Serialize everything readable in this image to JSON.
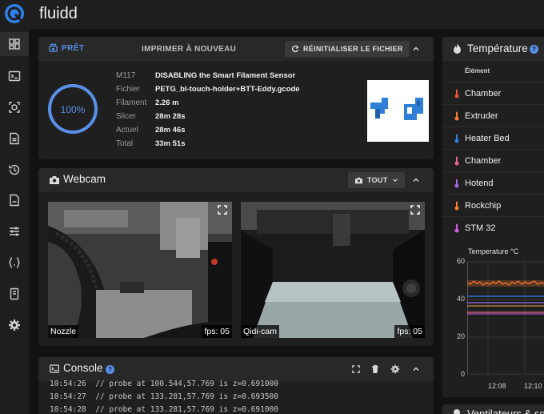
{
  "app": {
    "title": "fluidd"
  },
  "sidebar": {
    "items": [
      {
        "name": "dashboard",
        "icon": "dashboard-icon",
        "active": true
      },
      {
        "name": "console",
        "icon": "console-icon"
      },
      {
        "name": "webcam",
        "icon": "camera-icon"
      },
      {
        "name": "jobs",
        "icon": "file-list-icon"
      },
      {
        "name": "history",
        "icon": "history-icon"
      },
      {
        "name": "config",
        "icon": "file-icon"
      },
      {
        "name": "tune",
        "icon": "tune-icon"
      },
      {
        "name": "macros",
        "icon": "braces-icon"
      },
      {
        "name": "system",
        "icon": "device-icon"
      },
      {
        "name": "settings",
        "icon": "gear-icon"
      }
    ]
  },
  "status_card": {
    "tab_label": "PRÊT",
    "reprint_label": "IMPRIMER À NOUVEAU",
    "reset_button": "RÉINITIALISER LE FICHIER",
    "progress_percent": 100,
    "progress_text": "100%",
    "rows": [
      {
        "label": "M117",
        "value": "DISABLING the Smart Filament Sensor"
      },
      {
        "label": "Fichier",
        "value": "PETG_bl-touch-holder+BTT-Eddy.gcode"
      },
      {
        "label": "Filament",
        "value": "2.26 m"
      },
      {
        "label": "Slicer",
        "value": "28m 28s"
      },
      {
        "label": "Actuel",
        "value": "28m 46s"
      },
      {
        "label": "Total",
        "value": "33m 51s"
      }
    ]
  },
  "webcam_card": {
    "title": "Webcam",
    "filter_button": "TOUT",
    "cams": [
      {
        "name": "Nozzle",
        "fps": "fps: 05"
      },
      {
        "name": "Qidi-cam",
        "fps": "fps: 05"
      }
    ]
  },
  "console_card": {
    "title": "Console",
    "lines": [
      "10:54:26  // probe at 100.544,57.769 is z=0.691000",
      "10:54:27  // probe at 133.281,57.769 is z=0.693500",
      "10:54:28  // probe at 133.281,57.769 is z=0.691000"
    ]
  },
  "temperature_card": {
    "title": "Température",
    "column_header": "Élément",
    "sensors": [
      {
        "name": "Chamber",
        "color": "#e8533a",
        "icon": "thermometer-icon"
      },
      {
        "name": "Extruder",
        "color": "#ff7a2e",
        "icon": "fire-icon"
      },
      {
        "name": "Heater Bed",
        "color": "#2f80ed",
        "icon": "radiator-icon"
      },
      {
        "name": "Chamber",
        "color": "#e06a8a",
        "icon": "thermometer-icon"
      },
      {
        "name": "Hotend",
        "color": "#a368e0",
        "icon": "thermometer-icon"
      },
      {
        "name": "Rockchip",
        "color": "#ff7a2e",
        "icon": "thermometer-icon"
      },
      {
        "name": "STM 32",
        "color": "#d060e0",
        "icon": "thermometer-icon"
      }
    ],
    "chart_label": "Temperature °C",
    "y_ticks": [
      "60",
      "40",
      "20",
      "0"
    ],
    "x_ticks": [
      "12:08",
      "12:10"
    ]
  },
  "fans_card": {
    "title": "Ventilateurs & sorties"
  },
  "colors": {
    "accent": "#5a8fe8",
    "card": "#1f1f1f",
    "header": "#282828"
  }
}
